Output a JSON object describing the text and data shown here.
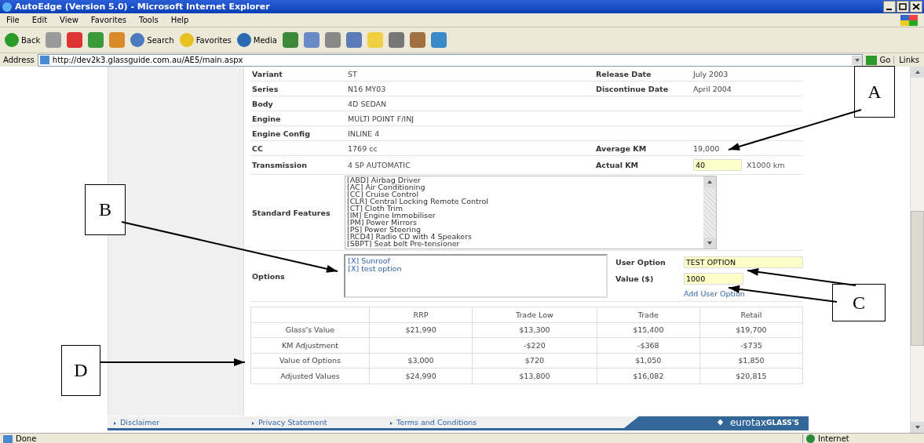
{
  "window": {
    "title": "AutoEdge (Version 5.0) - Microsoft Internet Explorer"
  },
  "menu": [
    "File",
    "Edit",
    "View",
    "Favorites",
    "Tools",
    "Help"
  ],
  "toolbar": [
    {
      "kind": "back",
      "label": "Back"
    },
    {
      "kind": "forward"
    },
    {
      "kind": "stop"
    },
    {
      "kind": "refresh"
    },
    {
      "kind": "home"
    },
    {
      "kind": "search",
      "label": "Search"
    },
    {
      "kind": "favorites",
      "label": "Favorites"
    },
    {
      "kind": "media",
      "label": "Media"
    },
    {
      "kind": "history"
    },
    {
      "kind": "mail"
    },
    {
      "kind": "print"
    },
    {
      "kind": "edit"
    },
    {
      "kind": "note"
    },
    {
      "kind": "page"
    },
    {
      "kind": "research"
    },
    {
      "kind": "messenger"
    }
  ],
  "address": {
    "label": "Address",
    "url": "http://dev2k3.glassguide.com.au/AE5/main.aspx",
    "go": "Go",
    "links": "Links"
  },
  "details": [
    {
      "label": "Variant",
      "value": "ST",
      "side": {
        "kind": "text",
        "label": "Release Date",
        "value": "July 2003"
      }
    },
    {
      "label": "Series",
      "value": "N16 MY03",
      "side": {
        "kind": "text",
        "label": "Discontinue Date",
        "value": "April 2004"
      }
    },
    {
      "label": "Body",
      "value": "4D SEDAN"
    },
    {
      "label": "Engine",
      "value": "MULTI POINT F/INJ"
    },
    {
      "label": "Engine Config",
      "value": "INLINE 4"
    },
    {
      "label": "CC",
      "value": "1769 cc",
      "side": {
        "kind": "text",
        "label": "Average KM",
        "value": "19,000"
      }
    },
    {
      "label": "Transmission",
      "value": "4 SP AUTOMATIC",
      "side": {
        "kind": "input",
        "label": "Actual KM",
        "value": "40",
        "unit": "X1000 km"
      }
    }
  ],
  "standard_features": {
    "label": "Standard Features",
    "items": [
      "[ABD] Airbag Driver",
      "[AC] Air Conditioning",
      "[CC] Cruise Control",
      "[CLR] Central Locking Remote Control",
      "[CT] Cloth Trim",
      "[IM] Engine Immobiliser",
      "[PM] Power Mirrors",
      "[PS] Power Steering",
      "[RCD4] Radio CD with 4 Speakers",
      "[SBPT] Seat belt Pre-tensioner"
    ]
  },
  "options": {
    "label": "Options",
    "items": [
      "[X] Sunroof",
      "[X] test option"
    ],
    "user_option": {
      "label": "User Option",
      "value": "TEST OPTION"
    },
    "value_field": {
      "label": "Value ($)",
      "value": "1000"
    },
    "add_link": "Add User Option"
  },
  "values_table": {
    "columns": [
      "RRP",
      "Trade Low",
      "Trade",
      "Retail"
    ],
    "rows": [
      {
        "label": "Glass's Value",
        "cells": [
          "$21,990",
          "$13,300",
          "$15,400",
          "$19,700"
        ]
      },
      {
        "label": "KM Adjustment",
        "cells": [
          null,
          "-$220",
          "-$368",
          "-$735"
        ]
      },
      {
        "label": "Value of Options",
        "cells": [
          "$3,000",
          "$720",
          "$1,050",
          "$1,850"
        ]
      },
      {
        "label": "Adjusted Values",
        "cells": [
          "$24,990",
          "$13,800",
          "$16,082",
          "$20,815"
        ]
      }
    ]
  },
  "footer": {
    "links": [
      "Disclaimer",
      "Privacy Statement",
      "Terms and Conditions"
    ],
    "logo": {
      "light": "eurotax",
      "bold": "GLASS'S"
    }
  },
  "status_bar": {
    "text": "Done",
    "zone": "Internet"
  },
  "callouts": [
    {
      "label": "A"
    },
    {
      "label": "B"
    },
    {
      "label": "C"
    },
    {
      "label": "D"
    }
  ]
}
